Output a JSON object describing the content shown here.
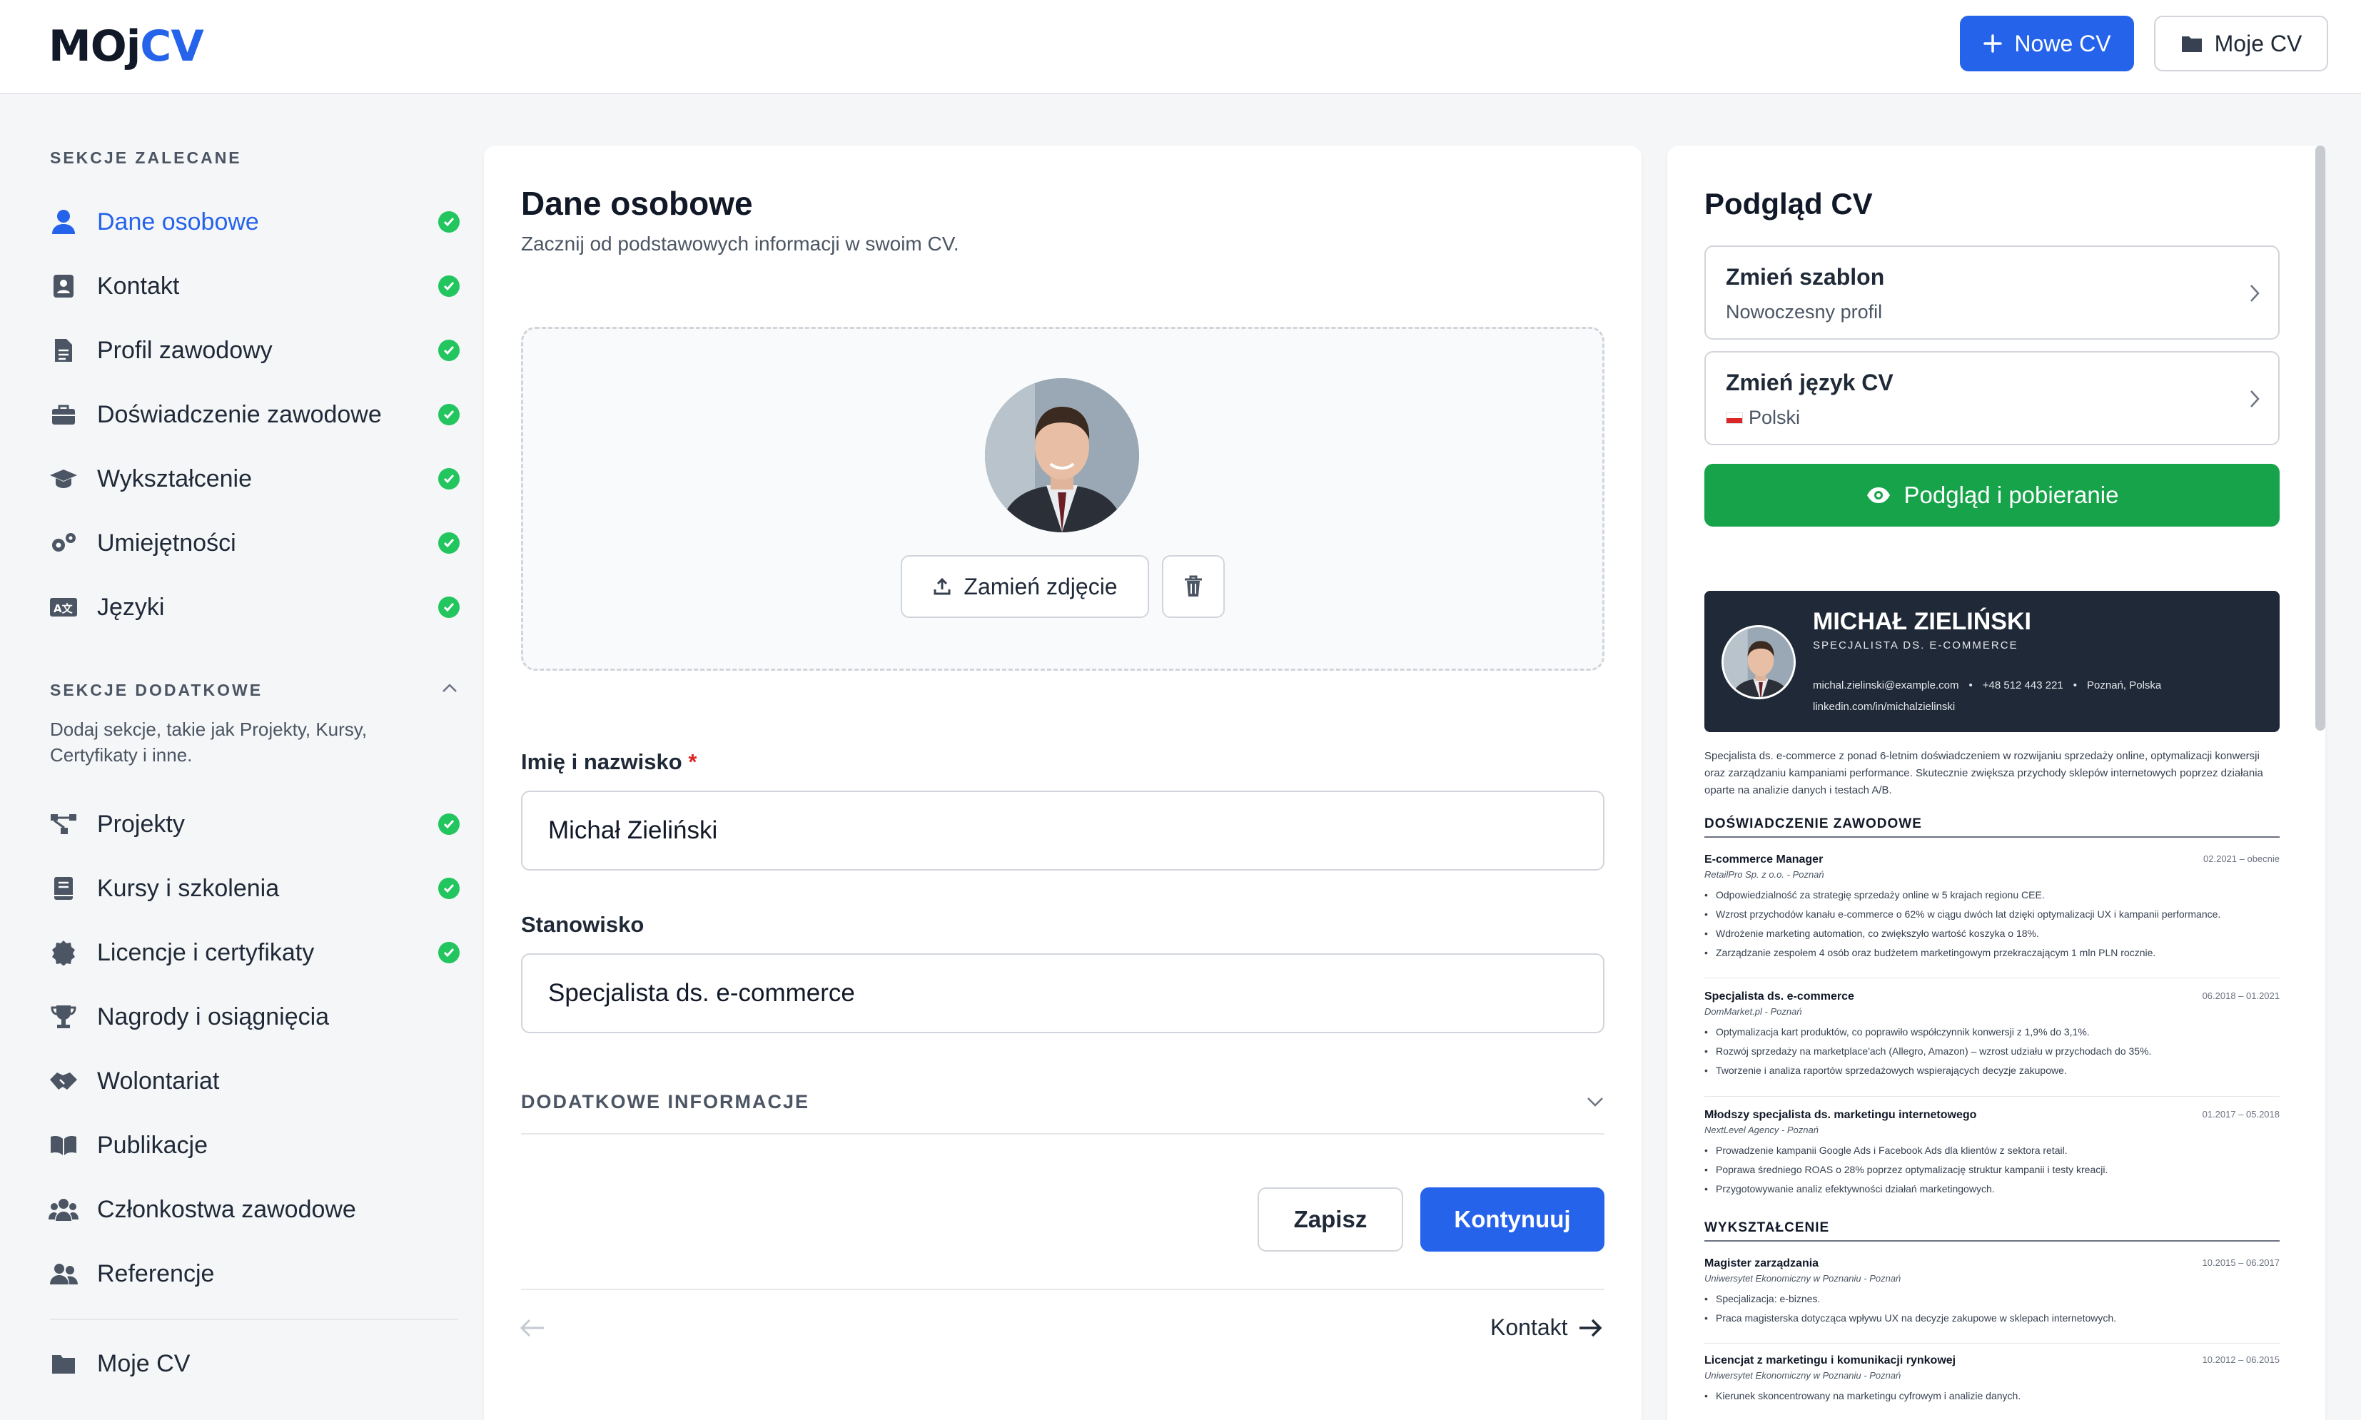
{
  "header": {
    "logo_part1": "MOj",
    "logo_part2": "CV",
    "new_cv_label": "Nowe CV",
    "my_cv_label": "Moje CV"
  },
  "sidebar": {
    "recommended_title": "SEKCJE ZALECANE",
    "recommended": [
      {
        "label": "Dane osobowe",
        "icon": "person-icon",
        "done": true
      },
      {
        "label": "Kontakt",
        "icon": "contact-card-icon",
        "done": true
      },
      {
        "label": "Profil zawodowy",
        "icon": "document-icon",
        "done": true
      },
      {
        "label": "Doświadczenie zawodowe",
        "icon": "briefcase-icon",
        "done": true
      },
      {
        "label": "Wykształcenie",
        "icon": "graduation-cap-icon",
        "done": true
      },
      {
        "label": "Umiejętności",
        "icon": "cogs-icon",
        "done": true
      },
      {
        "label": "Języki",
        "icon": "language-icon",
        "done": true
      }
    ],
    "additional_title": "SEKCJE DODATKOWE",
    "additional_desc": "Dodaj sekcje, takie jak Projekty, Kursy, Certyfikaty i inne.",
    "additional": [
      {
        "label": "Projekty",
        "icon": "project-diagram-icon",
        "done": true
      },
      {
        "label": "Kursy i szkolenia",
        "icon": "book-icon",
        "done": true
      },
      {
        "label": "Licencje i certyfikaty",
        "icon": "certificate-icon",
        "done": true
      },
      {
        "label": "Nagrody i osiągnięcia",
        "icon": "trophy-icon",
        "done": false
      },
      {
        "label": "Wolontariat",
        "icon": "handshake-icon",
        "done": false
      },
      {
        "label": "Publikacje",
        "icon": "open-book-icon",
        "done": false
      },
      {
        "label": "Członkostwa zawodowe",
        "icon": "users-icon",
        "done": false
      },
      {
        "label": "Referencje",
        "icon": "user-group-icon",
        "done": false
      }
    ],
    "my_cv_label": "Moje CV"
  },
  "form": {
    "title": "Dane osobowe",
    "subtitle": "Zacznij od podstawowych informacji w swoim CV.",
    "replace_photo_label": "Zamień zdjęcie",
    "name_label": "Imię i nazwisko",
    "name_required": "*",
    "name_value": "Michał Zieliński",
    "position_label": "Stanowisko",
    "position_value": "Specjalista ds. e-commerce",
    "extra_label": "DODATKOWE INFORMACJE",
    "save_label": "Zapisz",
    "continue_label": "Kontynuuj",
    "next_label": "Kontakt"
  },
  "preview": {
    "title": "Podgląd CV",
    "template_title": "Zmień szablon",
    "template_value": "Nowoczesny profil",
    "language_title": "Zmień język CV",
    "language_value": "Polski",
    "preview_button": "Podgląd i pobieranie",
    "cv": {
      "name": "MICHAŁ ZIELIŃSKI",
      "role": "SPECJALISTA DS. E-COMMERCE",
      "email": "michal.zielinski@example.com",
      "phone": "+48 512 443 221",
      "city": "Poznań, Polska",
      "linkedin": "linkedin.com/in/michalzielinski",
      "summary": "Specjalista ds. e-commerce z ponad 6-letnim doświadczeniem w rozwijaniu sprzedaży online, optymalizacji konwersji oraz zarządzaniu kampaniami performance. Skutecznie zwiększa przychody sklepów internetowych poprzez działania oparte na analizie danych i testach A/B.",
      "experience_title": "DOŚWIADCZENIE ZAWODOWE",
      "jobs": [
        {
          "title": "E-commerce Manager",
          "company": "RetailPro Sp. z o.o. - Poznań",
          "dates": "02.2021 – obecnie",
          "bullets": [
            "Odpowiedzialność za strategię sprzedaży online w 5 krajach regionu CEE.",
            "Wzrost przychodów kanału e-commerce o 62% w ciągu dwóch lat dzięki optymalizacji UX i kampanii performance.",
            "Wdrożenie marketing automation, co zwiększyło wartość koszyka o 18%.",
            "Zarządzanie zespołem 4 osób oraz budżetem marketingowym przekraczającym 1 mln PLN rocznie."
          ]
        },
        {
          "title": "Specjalista ds. e-commerce",
          "company": "DomMarket.pl - Poznań",
          "dates": "06.2018 – 01.2021",
          "bullets": [
            "Optymalizacja kart produktów, co poprawiło współczynnik konwersji z 1,9% do 3,1%.",
            "Rozwój sprzedaży na marketplace'ach (Allegro, Amazon) – wzrost udziału w przychodach do 35%.",
            "Tworzenie i analiza raportów sprzedażowych wspierających decyzje zakupowe."
          ]
        },
        {
          "title": "Młodszy specjalista ds. marketingu internetowego",
          "company": "NextLevel Agency - Poznań",
          "dates": "01.2017 – 05.2018",
          "bullets": [
            "Prowadzenie kampanii Google Ads i Facebook Ads dla klientów z sektora retail.",
            "Poprawa średniego ROAS o 28% poprzez optymalizację struktur kampanii i testy kreacji.",
            "Przygotowywanie analiz efektywności działań marketingowych."
          ]
        }
      ],
      "education_title": "WYKSZTAŁCENIE",
      "education": [
        {
          "title": "Magister zarządzania",
          "school": "Uniwersytet Ekonomiczny w Poznaniu - Poznań",
          "dates": "10.2015 – 06.2017",
          "bullets": [
            "Specjalizacja: e-biznes.",
            "Praca magisterska dotycząca wpływu UX na decyzje zakupowe w sklepach internetowych."
          ]
        },
        {
          "title": "Licencjat z marketingu i komunikacji rynkowej",
          "school": "Uniwersytet Ekonomiczny w Poznaniu - Poznań",
          "dates": "10.2012 – 06.2015",
          "bullets": [
            "Kierunek skoncentrowany na marketingu cyfrowym i analizie danych."
          ]
        }
      ]
    }
  },
  "colors": {
    "accent": "#2563eb",
    "success": "#22c55e",
    "preview_button": "#16a34a",
    "cv_header": "#1f2937"
  }
}
